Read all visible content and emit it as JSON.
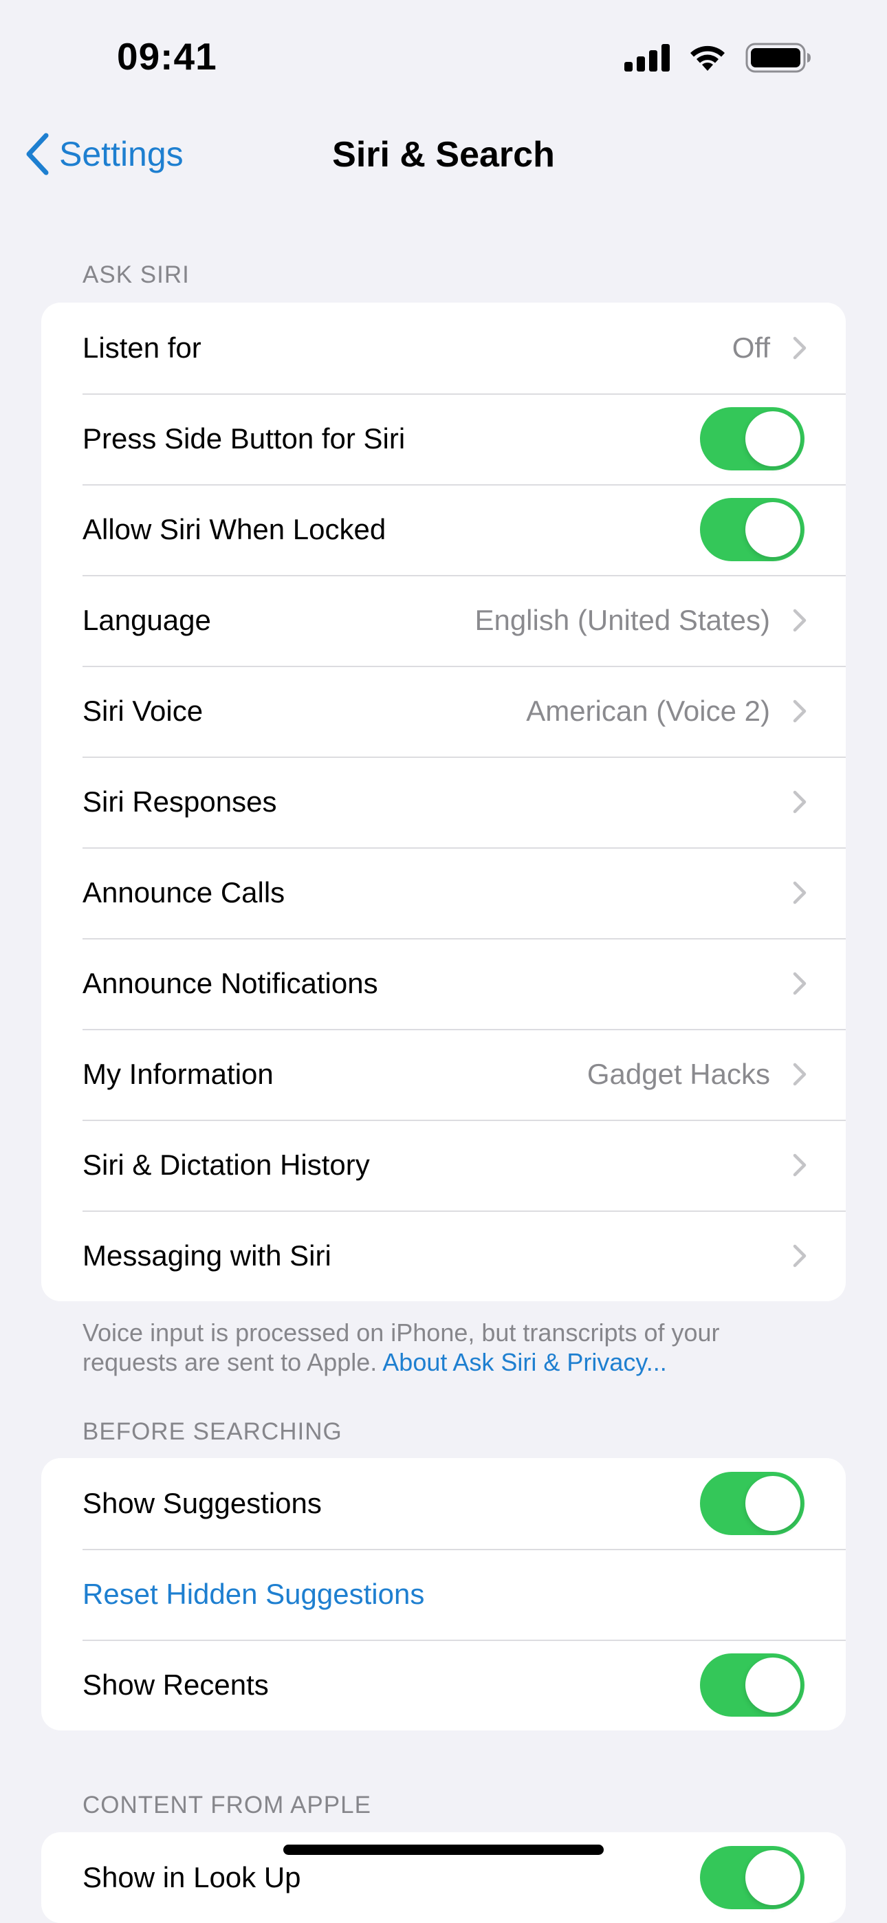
{
  "status_bar": {
    "time": "09:41",
    "icons": [
      "cellular-signal-icon",
      "wifi-icon",
      "battery-icon"
    ]
  },
  "nav": {
    "back_label": "Settings",
    "title": "Siri & Search"
  },
  "ask_siri": {
    "header": "ASK SIRI",
    "rows": [
      {
        "label": "Listen for",
        "value": "Off",
        "control": "chevron"
      },
      {
        "label": "Press Side Button for Siri",
        "control": "toggle",
        "on": true
      },
      {
        "label": "Allow Siri When Locked",
        "control": "toggle",
        "on": true
      },
      {
        "label": "Language",
        "value": "English (United States)",
        "control": "chevron"
      },
      {
        "label": "Siri Voice",
        "value": "American (Voice 2)",
        "control": "chevron"
      },
      {
        "label": "Siri Responses",
        "control": "chevron"
      },
      {
        "label": "Announce Calls",
        "control": "chevron"
      },
      {
        "label": "Announce Notifications",
        "control": "chevron"
      },
      {
        "label": "My Information",
        "value": "Gadget Hacks",
        "control": "chevron"
      },
      {
        "label": "Siri & Dictation History",
        "control": "chevron"
      },
      {
        "label": "Messaging with Siri",
        "control": "chevron"
      }
    ],
    "footer_text": "Voice input is processed on iPhone, but transcripts of your requests are sent to Apple.",
    "footer_link": "About Ask Siri & Privacy..."
  },
  "before_searching": {
    "header": "BEFORE SEARCHING",
    "rows": [
      {
        "label": "Show Suggestions",
        "control": "toggle",
        "on": true
      },
      {
        "label": "Reset Hidden Suggestions",
        "control": "link"
      },
      {
        "label": "Show Recents",
        "control": "toggle",
        "on": true
      }
    ]
  },
  "content_from_apple": {
    "header": "CONTENT FROM APPLE",
    "rows": [
      {
        "label": "Show in Look Up",
        "control": "toggle",
        "on": true
      }
    ]
  },
  "colors": {
    "background": "#f2f2f7",
    "accent": "#1e7fd0",
    "toggle_on": "#34c759",
    "secondary_text": "#8a8a8e"
  }
}
